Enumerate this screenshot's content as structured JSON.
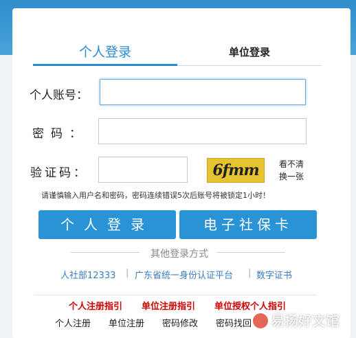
{
  "tabs": [
    {
      "label": "个人登录",
      "active": true
    },
    {
      "label": "单位登录",
      "active": false
    }
  ],
  "form": {
    "account_label": "个人账号：",
    "password_label": "密码：",
    "captcha_label": "验证码：",
    "account_value": "",
    "password_value": "",
    "captcha_value": "",
    "captcha_text": "6fmm",
    "refresh_line1": "看不清",
    "refresh_line2": "换一张",
    "notice": "请谨慎输入用户名和密码，密码连续错误5次后账号将被锁定1小时！"
  },
  "buttons": {
    "login": "个人登录",
    "social_card": "电子社保卡"
  },
  "other_login": {
    "title": "其他登录方式",
    "links": [
      "人社部12333",
      "广东省统一身份认证平台",
      "数字证书"
    ],
    "separator": "|"
  },
  "guides": [
    "个人注册指引",
    "单位注册指引",
    "单位授权个人指引"
  ],
  "bottom_links": [
    "个人注册",
    "单位注册",
    "密码修改",
    "密码找回"
  ],
  "watermark": "易扬好文馆",
  "colors": {
    "accent": "#2a93d5",
    "guide_red": "#d10000",
    "link_blue": "#3a7cc0"
  }
}
